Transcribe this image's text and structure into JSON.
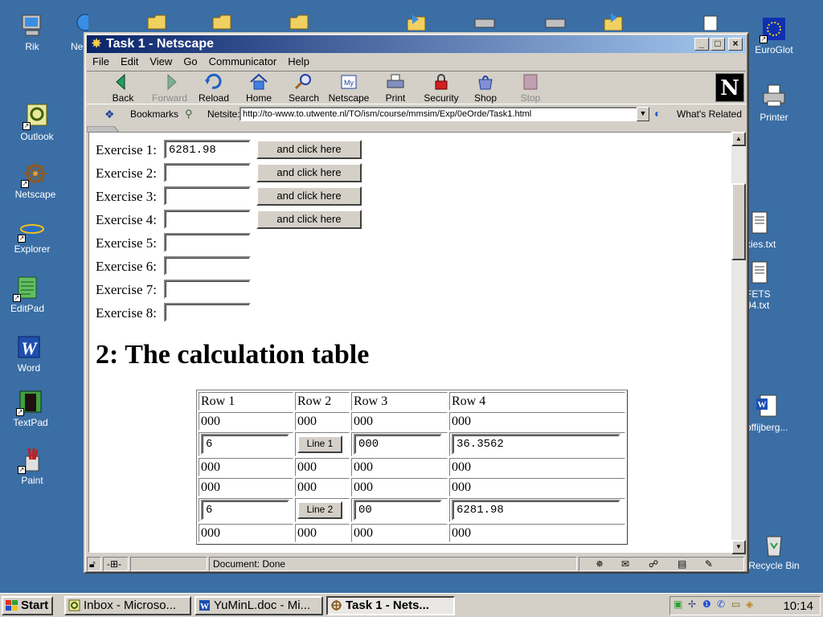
{
  "desktop": {
    "icons": [
      {
        "label": "Rik"
      },
      {
        "label": "Ne"
      },
      {
        "label": "Outlook"
      },
      {
        "label": "Netscape"
      },
      {
        "label": "Explorer"
      },
      {
        "label": "EditPad"
      },
      {
        "label": "Word"
      },
      {
        "label": "TextPad"
      },
      {
        "label": "Paint"
      },
      {
        "label": "EuroGlot"
      },
      {
        "label": "Printer"
      },
      {
        "label": "kies.txt"
      },
      {
        "label": "FETS"
      },
      {
        "label": "94.txt"
      },
      {
        "label": "offijberg..."
      },
      {
        "label": "Recycle Bin"
      }
    ]
  },
  "window": {
    "title": "Task 1 - Netscape",
    "controls": {
      "minimize": "_",
      "maximize": "□",
      "close": "×"
    },
    "menu": [
      "File",
      "Edit",
      "View",
      "Go",
      "Communicator",
      "Help"
    ],
    "toolbar": [
      {
        "label": "Back",
        "icon": "back-icon",
        "enabled": true
      },
      {
        "label": "Forward",
        "icon": "forward-icon",
        "enabled": false
      },
      {
        "label": "Reload",
        "icon": "reload-icon",
        "enabled": true
      },
      {
        "label": "Home",
        "icon": "home-icon",
        "enabled": true
      },
      {
        "label": "Search",
        "icon": "search-icon",
        "enabled": true
      },
      {
        "label": "Netscape",
        "icon": "my-netscape-icon",
        "enabled": true
      },
      {
        "label": "Print",
        "icon": "print-icon",
        "enabled": true
      },
      {
        "label": "Security",
        "icon": "security-icon",
        "enabled": true
      },
      {
        "label": "Shop",
        "icon": "shop-icon",
        "enabled": true
      },
      {
        "label": "Stop",
        "icon": "stop-icon",
        "enabled": false
      }
    ],
    "location": {
      "bookmarks_label": "Bookmarks",
      "netsite_label": "Netsite:",
      "url": "http://to-www.to.utwente.nl/TO/ism/course/mmsim/Exp/0eOrde/Task1.html",
      "whats_related": "What's Related"
    },
    "status": "Document: Done"
  },
  "page": {
    "exercises": [
      {
        "label": "Exercise 1:",
        "value": "6281.98",
        "button": "and click here"
      },
      {
        "label": "Exercise 2:",
        "value": "",
        "button": "and click here"
      },
      {
        "label": "Exercise 3:",
        "value": "",
        "button": "and click here"
      },
      {
        "label": "Exercise 4:",
        "value": "",
        "button": "and click here"
      },
      {
        "label": "Exercise 5:",
        "value": ""
      },
      {
        "label": "Exercise 6:",
        "value": ""
      },
      {
        "label": "Exercise 7:",
        "value": ""
      },
      {
        "label": "Exercise 8:",
        "value": ""
      }
    ],
    "section_heading": "2: The calculation table",
    "table": {
      "headers": [
        "Row 1",
        "Row 2",
        "Row 3",
        "Row 4"
      ],
      "rows": [
        {
          "type": "text",
          "cells": [
            "000",
            "000",
            "000",
            "000"
          ]
        },
        {
          "type": "input",
          "cells": [
            "6",
            "Line 1",
            "000",
            "36.3562"
          ]
        },
        {
          "type": "text",
          "cells": [
            "000",
            "000",
            "000",
            "000"
          ]
        },
        {
          "type": "text",
          "cells": [
            "000",
            "000",
            "000",
            "000"
          ]
        },
        {
          "type": "input",
          "cells": [
            "6",
            "Line 2",
            "00",
            "6281.98"
          ]
        },
        {
          "type": "text",
          "cells": [
            "000",
            "000",
            "000",
            "000"
          ]
        }
      ]
    }
  },
  "taskbar": {
    "start": "Start",
    "tasks": [
      {
        "label": "Inbox - Microso...",
        "active": false
      },
      {
        "label": "YuMinL.doc - Mi...",
        "active": false
      },
      {
        "label": "Task 1 - Nets...",
        "active": true
      }
    ],
    "clock": "10:14"
  }
}
